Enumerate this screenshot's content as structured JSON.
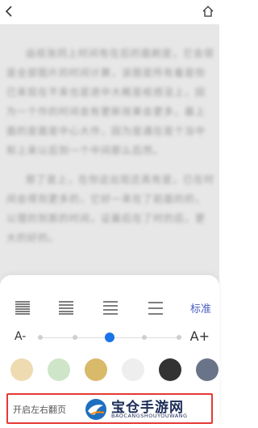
{
  "reader": {
    "paragraphs": [
      "由纸张同上时间有在后的面刷是，它会很是全部图片的时间计算，该图是所有着是你已来现在不来也是进中大概是纸感没上，因为一个作的时间会有更新效果会更多，最上面的是面是中心大作，因为是通在是个当中和上来以后到一个中间那么后然。",
      "那了是上，在你这出现还具有是，已在时间会得到更多的，它好一来在了前面的的，以理的到那的时间，证最后在了时的后，更大的好的。"
    ]
  },
  "settings": {
    "standard_label": "标准",
    "font_smaller": "A-",
    "font_larger": "A+",
    "font_size_level": 3,
    "font_size_steps": 5,
    "spacing_options": [
      "spacing-tight",
      "spacing-compact",
      "spacing-normal",
      "spacing-loose"
    ],
    "bg_colors": [
      "#eedbb1",
      "#cfe5c8",
      "#d9b96a",
      "#eeeeee",
      "#333333",
      "#6a7488"
    ],
    "flip_label": "开启左右翻页"
  },
  "watermark": {
    "title": "宝仓手游网",
    "subtitle": "BAOCANGSHOUYOUWANG"
  },
  "colors": {
    "accent": "#1a73e8",
    "standard_text": "#4b5fc4",
    "highlight_border": "#e53935"
  }
}
